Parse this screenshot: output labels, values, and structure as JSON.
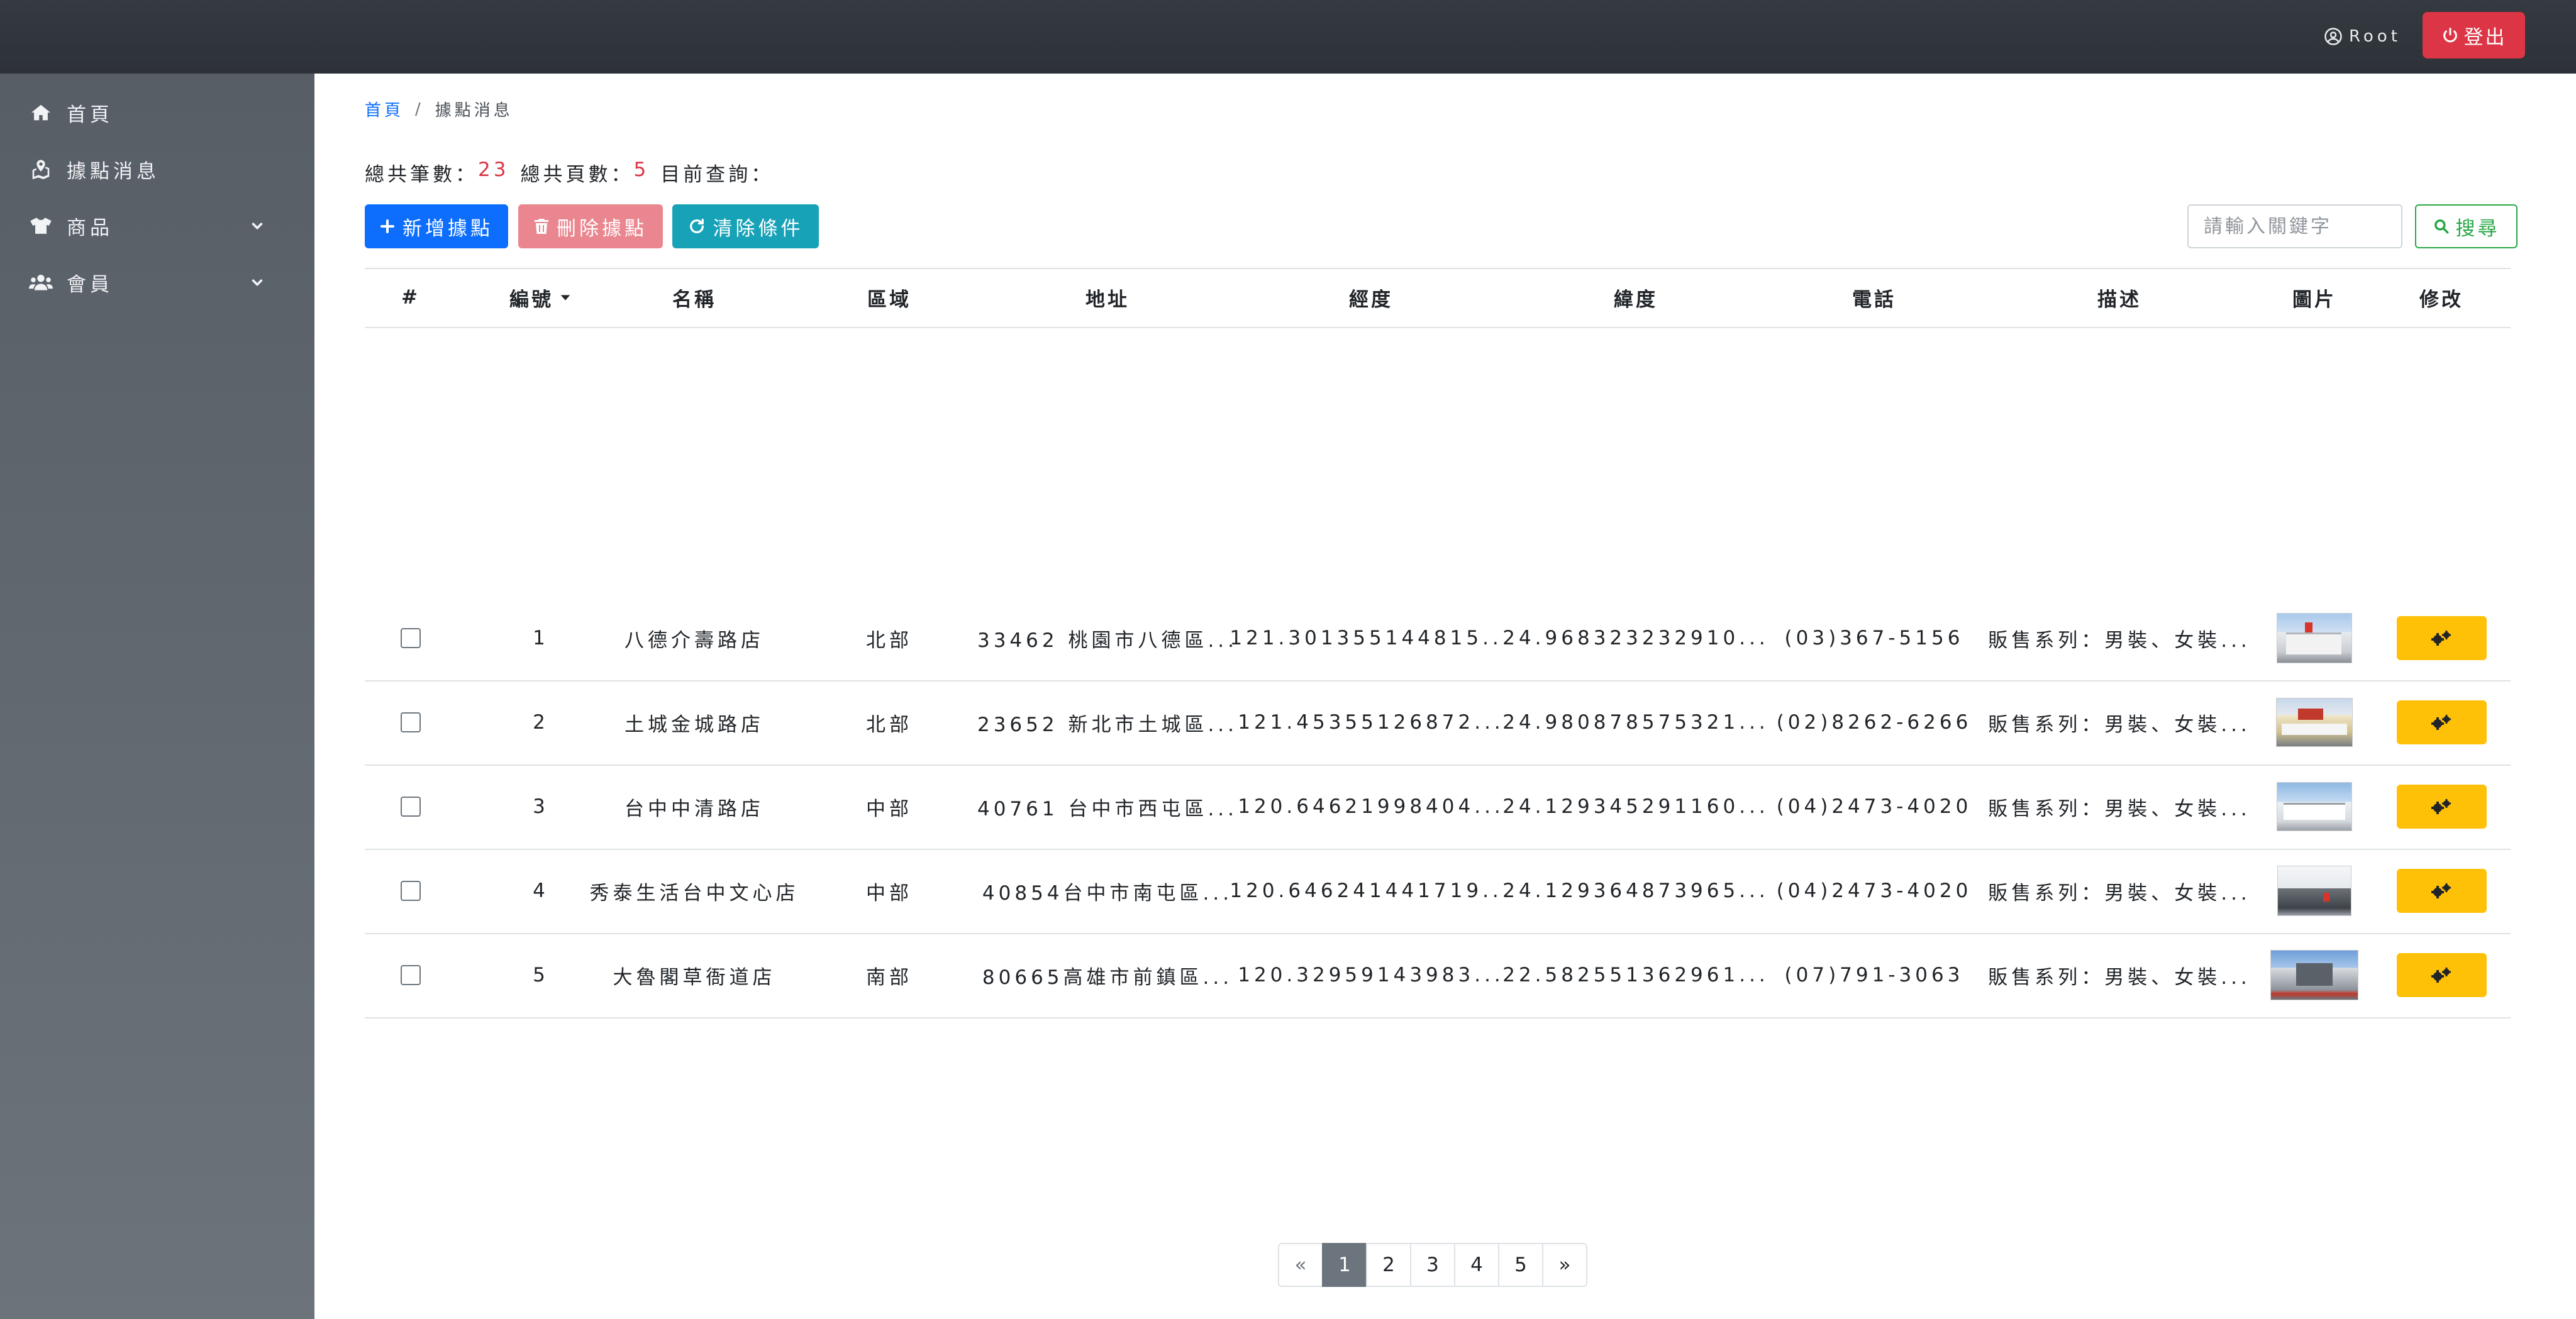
{
  "header": {
    "user_label": "Root",
    "logout_label": "登出"
  },
  "sidebar": {
    "items": [
      {
        "label": "首頁",
        "icon": "home-icon"
      },
      {
        "label": "據點消息",
        "icon": "map-marker-icon"
      },
      {
        "label": "商品",
        "icon": "tshirt-icon",
        "expandable": true
      },
      {
        "label": "會員",
        "icon": "users-icon",
        "expandable": true
      }
    ]
  },
  "breadcrumb": {
    "home": "首頁",
    "separator": "/",
    "current": "據點消息"
  },
  "summary": {
    "total_records_label": "總共筆數：",
    "total_records": "23",
    "total_pages_label": "總共頁數：",
    "total_pages": "5",
    "current_query_label": "目前查詢："
  },
  "toolbar": {
    "add_label": "新增據點",
    "delete_label": "刪除據點",
    "clear_label": "清除條件",
    "search_placeholder": "請輸入關鍵字",
    "search_value": "",
    "search_label": "搜尋"
  },
  "table": {
    "headers": {
      "select": "#",
      "id": "編號",
      "name": "名稱",
      "region": "區域",
      "address": "地址",
      "longitude": "經度",
      "latitude": "緯度",
      "phone": "電話",
      "description": "描述",
      "image": "圖片",
      "edit": "修改"
    },
    "rows": [
      {
        "id": "1",
        "name": "八德介壽路店",
        "region": "北部",
        "address": "33462 桃園市八德區...",
        "longitude": "121.301355144815...",
        "latitude": "24.968323232910...",
        "phone": "(03)367-5156",
        "description": "販售系列：男裝、女裝..."
      },
      {
        "id": "2",
        "name": "土城金城路店",
        "region": "北部",
        "address": "23652 新北市土城區...",
        "longitude": "121.45355126872...",
        "latitude": "24.980878575321...",
        "phone": "(02)8262-6266",
        "description": "販售系列：男裝、女裝..."
      },
      {
        "id": "3",
        "name": "台中中清路店",
        "region": "中部",
        "address": "40761 台中市西屯區...",
        "longitude": "120.64621998404...",
        "latitude": "24.129345291160...",
        "phone": "(04)2473-4020",
        "description": "販售系列：男裝、女裝..."
      },
      {
        "id": "4",
        "name": "秀泰生活台中文心店",
        "region": "中部",
        "address": "40854台中市南屯區...",
        "longitude": "120.646241441719...",
        "latitude": "24.129364873965...",
        "phone": "(04)2473-4020",
        "description": "販售系列：男裝、女裝..."
      },
      {
        "id": "5",
        "name": "大魯閣草衙道店",
        "region": "南部",
        "address": "80665高雄市前鎮區...",
        "longitude": "120.32959143983...",
        "latitude": "22.582551362961...",
        "phone": "(07)791-3063",
        "description": "販售系列：男裝、女裝..."
      }
    ]
  },
  "pagination": {
    "prev": "«",
    "pages": [
      "1",
      "2",
      "3",
      "4",
      "5"
    ],
    "active": "1",
    "next": "»"
  },
  "colors": {
    "topbar": "#343a40",
    "sidebar": "#6c737b",
    "primary": "#0d6efd",
    "danger": "#dc3545",
    "info": "#17a2b8",
    "success": "#28a745",
    "warning": "#ffc107"
  }
}
